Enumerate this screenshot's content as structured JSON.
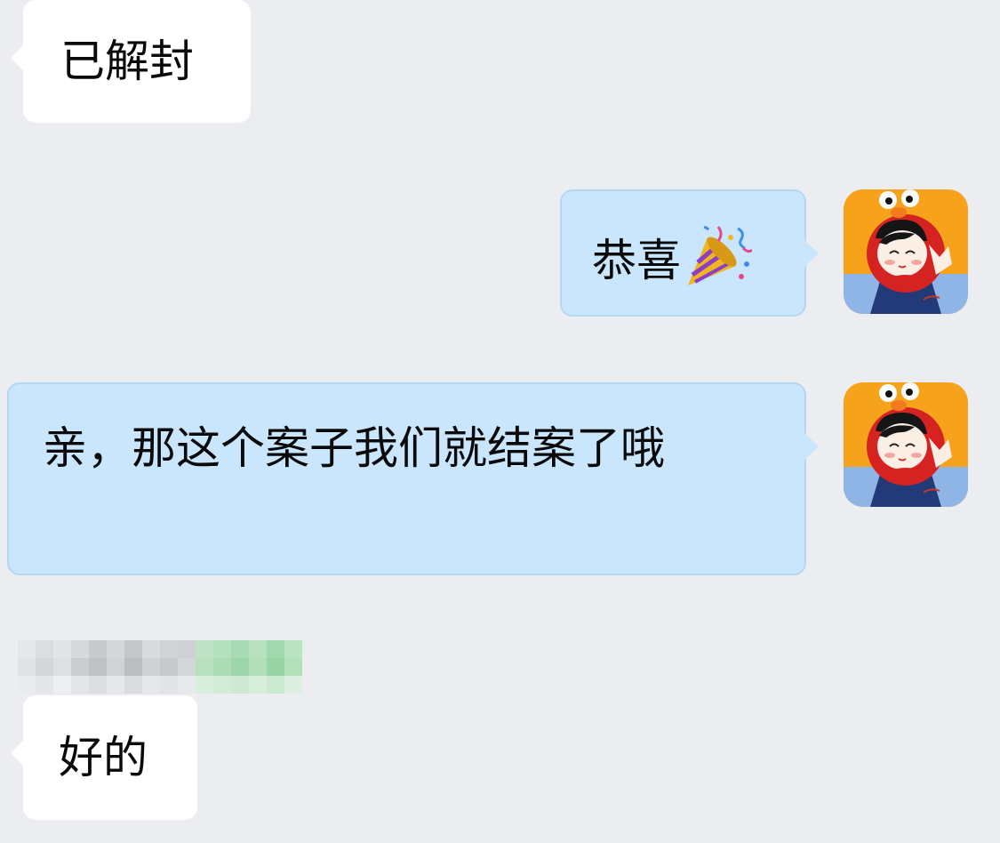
{
  "messages": [
    {
      "side": "left",
      "text": "已解封"
    },
    {
      "side": "right",
      "text": "恭喜",
      "emoji": "party-popper-icon"
    },
    {
      "side": "right",
      "text": "亲，那这个案子我们就结案了哦"
    },
    {
      "side": "left",
      "text": "好的"
    }
  ],
  "colors": {
    "background": "#ebedf1",
    "incoming_bubble": "#ffffff",
    "outgoing_bubble": "#c9e6fd",
    "outgoing_border": "#b4d7f3"
  }
}
